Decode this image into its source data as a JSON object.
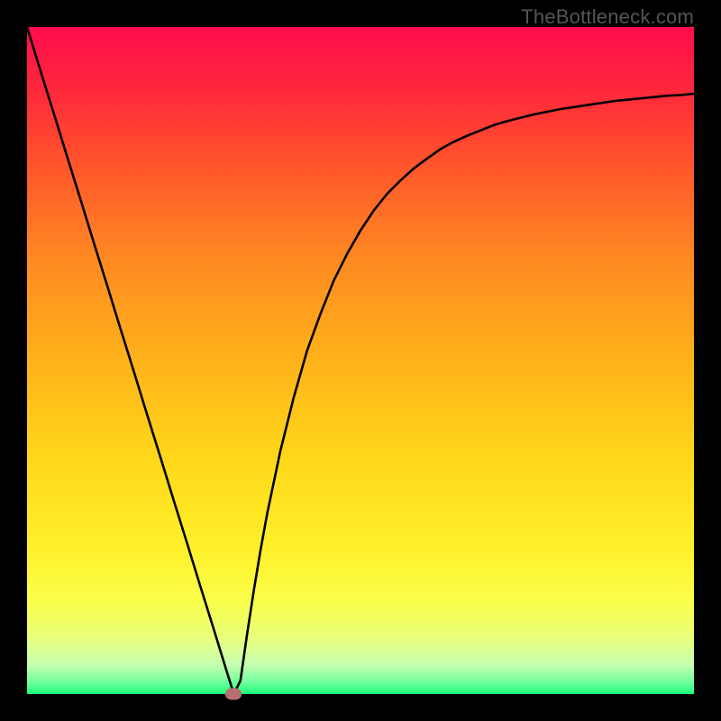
{
  "branding": "TheBottleneck.com",
  "chart_data": {
    "type": "line",
    "title": "",
    "xlabel": "",
    "ylabel": "",
    "xlim": [
      0,
      100
    ],
    "ylim": [
      0,
      100
    ],
    "x": [
      0,
      2,
      4,
      6,
      8,
      10,
      12,
      14,
      16,
      18,
      20,
      22,
      24,
      26,
      28,
      30,
      31,
      32,
      33,
      34,
      35,
      36,
      38,
      40,
      42,
      44,
      46,
      48,
      50,
      52,
      54,
      56,
      58,
      60,
      62,
      64,
      66,
      68,
      70,
      72,
      74,
      76,
      78,
      80,
      82,
      84,
      86,
      88,
      90,
      92,
      94,
      96,
      98,
      100
    ],
    "y": [
      100,
      93.5,
      87.1,
      80.6,
      74.2,
      67.7,
      61.3,
      54.8,
      48.4,
      41.9,
      35.5,
      29.0,
      22.6,
      16.1,
      9.7,
      3.2,
      0.0,
      2.0,
      9.0,
      15.5,
      21.5,
      27.0,
      36.5,
      44.5,
      51.5,
      57.0,
      62.0,
      66.0,
      69.5,
      72.5,
      75.0,
      77.0,
      78.8,
      80.3,
      81.7,
      82.8,
      83.7,
      84.5,
      85.3,
      85.9,
      86.4,
      86.9,
      87.3,
      87.7,
      88.0,
      88.3,
      88.6,
      88.9,
      89.1,
      89.3,
      89.5,
      89.7,
      89.8,
      90.0
    ],
    "marker": {
      "x": 31,
      "y": 0
    },
    "gradient_stops": [
      {
        "pos": 0.0,
        "color": "#ff0d4e"
      },
      {
        "pos": 0.1,
        "color": "#ff2a3a"
      },
      {
        "pos": 0.22,
        "color": "#ff5a2a"
      },
      {
        "pos": 0.35,
        "color": "#ff8a22"
      },
      {
        "pos": 0.5,
        "color": "#ffb21a"
      },
      {
        "pos": 0.65,
        "color": "#ffd81a"
      },
      {
        "pos": 0.78,
        "color": "#fff02a"
      },
      {
        "pos": 0.86,
        "color": "#faff4a"
      },
      {
        "pos": 0.915,
        "color": "#eaff7a"
      },
      {
        "pos": 0.955,
        "color": "#c8ffb0"
      },
      {
        "pos": 0.98,
        "color": "#7affa0"
      },
      {
        "pos": 1.0,
        "color": "#1aff7a"
      }
    ],
    "marker_color": "#b86f6f",
    "curve_color": "#000000"
  }
}
